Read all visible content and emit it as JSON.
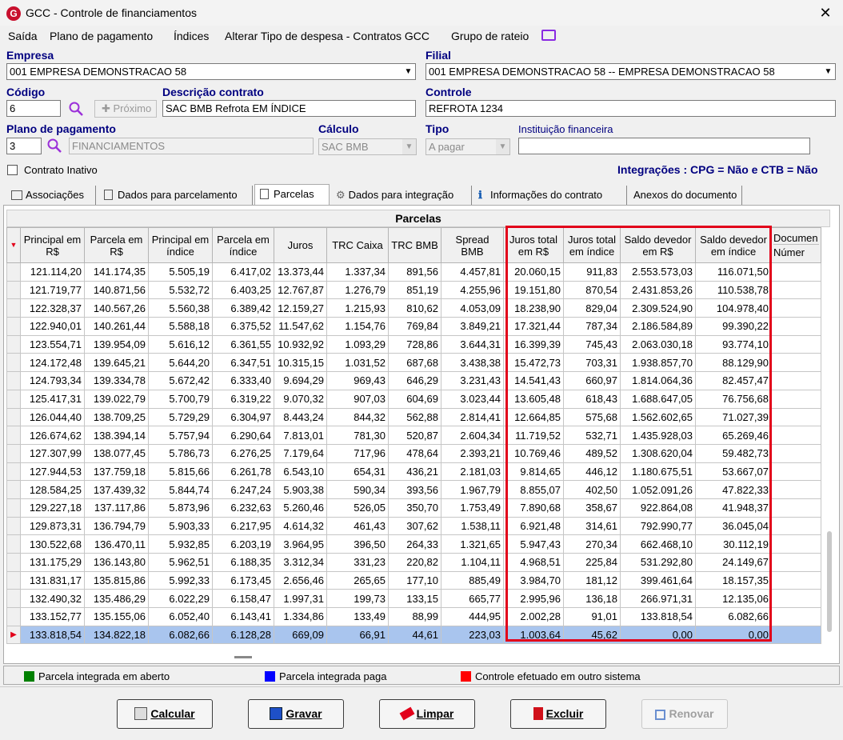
{
  "window": {
    "title": "GCC - Controle de financiamentos",
    "logo": "G",
    "close": "✕"
  },
  "menu": [
    "Saída",
    "Plano de pagamento",
    "Índices",
    "Alterar Tipo de despesa - Contratos GCC",
    "Grupo de rateio"
  ],
  "form": {
    "empresa_label": "Empresa",
    "empresa_value": "001 EMPRESA DEMONSTRACAO 58",
    "filial_label": "Filial",
    "filial_value": "001 EMPRESA DEMONSTRACAO 58 -- EMPRESA DEMONSTRACAO 58",
    "codigo_label": "Código",
    "codigo_value": "6",
    "proximo_label": "Próximo",
    "descricao_label": "Descrição contrato",
    "descricao_value": "SAC BMB Refrota EM ÍNDICE",
    "controle_label": "Controle",
    "controle_value": "REFROTA 1234",
    "plano_label": "Plano de pagamento",
    "plano_code": "3",
    "plano_name": "FINANCIAMENTOS",
    "calculo_label": "Cálculo",
    "calculo_value": "SAC BMB",
    "tipo_label": "Tipo",
    "tipo_value": "A pagar",
    "instituicao_label": "Instituição financeira",
    "instituicao_value": "",
    "inativo_label": "Contrato Inativo",
    "integracoes": "Integrações : CPG = Não e CTB = Não"
  },
  "tabs": [
    "Associações",
    "Dados para parcelamento",
    "Parcelas",
    "Dados para integração",
    "Informações do contrato",
    "Anexos do documento"
  ],
  "grid": {
    "caption": "Parcelas",
    "headers": [
      "Principal em R$",
      "Parcela em R$",
      "Principal em índice",
      "Parcela em índice",
      "Juros",
      "TRC Caixa",
      "TRC BMB",
      "Spread BMB",
      "Juros total em R$",
      "Juros total em índice",
      "Saldo devedor em R$",
      "Saldo devedor em índice"
    ],
    "header_extra_top": "Documen",
    "header_extra_bottom": "Númer",
    "rows": [
      [
        "121.114,20",
        "141.174,35",
        "5.505,19",
        "6.417,02",
        "13.373,44",
        "1.337,34",
        "891,56",
        "4.457,81",
        "20.060,15",
        "911,83",
        "2.553.573,03",
        "116.071,50"
      ],
      [
        "121.719,77",
        "140.871,56",
        "5.532,72",
        "6.403,25",
        "12.767,87",
        "1.276,79",
        "851,19",
        "4.255,96",
        "19.151,80",
        "870,54",
        "2.431.853,26",
        "110.538,78"
      ],
      [
        "122.328,37",
        "140.567,26",
        "5.560,38",
        "6.389,42",
        "12.159,27",
        "1.215,93",
        "810,62",
        "4.053,09",
        "18.238,90",
        "829,04",
        "2.309.524,90",
        "104.978,40"
      ],
      [
        "122.940,01",
        "140.261,44",
        "5.588,18",
        "6.375,52",
        "11.547,62",
        "1.154,76",
        "769,84",
        "3.849,21",
        "17.321,44",
        "787,34",
        "2.186.584,89",
        "99.390,22"
      ],
      [
        "123.554,71",
        "139.954,09",
        "5.616,12",
        "6.361,55",
        "10.932,92",
        "1.093,29",
        "728,86",
        "3.644,31",
        "16.399,39",
        "745,43",
        "2.063.030,18",
        "93.774,10"
      ],
      [
        "124.172,48",
        "139.645,21",
        "5.644,20",
        "6.347,51",
        "10.315,15",
        "1.031,52",
        "687,68",
        "3.438,38",
        "15.472,73",
        "703,31",
        "1.938.857,70",
        "88.129,90"
      ],
      [
        "124.793,34",
        "139.334,78",
        "5.672,42",
        "6.333,40",
        "9.694,29",
        "969,43",
        "646,29",
        "3.231,43",
        "14.541,43",
        "660,97",
        "1.814.064,36",
        "82.457,47"
      ],
      [
        "125.417,31",
        "139.022,79",
        "5.700,79",
        "6.319,22",
        "9.070,32",
        "907,03",
        "604,69",
        "3.023,44",
        "13.605,48",
        "618,43",
        "1.688.647,05",
        "76.756,68"
      ],
      [
        "126.044,40",
        "138.709,25",
        "5.729,29",
        "6.304,97",
        "8.443,24",
        "844,32",
        "562,88",
        "2.814,41",
        "12.664,85",
        "575,68",
        "1.562.602,65",
        "71.027,39"
      ],
      [
        "126.674,62",
        "138.394,14",
        "5.757,94",
        "6.290,64",
        "7.813,01",
        "781,30",
        "520,87",
        "2.604,34",
        "11.719,52",
        "532,71",
        "1.435.928,03",
        "65.269,46"
      ],
      [
        "127.307,99",
        "138.077,45",
        "5.786,73",
        "6.276,25",
        "7.179,64",
        "717,96",
        "478,64",
        "2.393,21",
        "10.769,46",
        "489,52",
        "1.308.620,04",
        "59.482,73"
      ],
      [
        "127.944,53",
        "137.759,18",
        "5.815,66",
        "6.261,78",
        "6.543,10",
        "654,31",
        "436,21",
        "2.181,03",
        "9.814,65",
        "446,12",
        "1.180.675,51",
        "53.667,07"
      ],
      [
        "128.584,25",
        "137.439,32",
        "5.844,74",
        "6.247,24",
        "5.903,38",
        "590,34",
        "393,56",
        "1.967,79",
        "8.855,07",
        "402,50",
        "1.052.091,26",
        "47.822,33"
      ],
      [
        "129.227,18",
        "137.117,86",
        "5.873,96",
        "6.232,63",
        "5.260,46",
        "526,05",
        "350,70",
        "1.753,49",
        "7.890,68",
        "358,67",
        "922.864,08",
        "41.948,37"
      ],
      [
        "129.873,31",
        "136.794,79",
        "5.903,33",
        "6.217,95",
        "4.614,32",
        "461,43",
        "307,62",
        "1.538,11",
        "6.921,48",
        "314,61",
        "792.990,77",
        "36.045,04"
      ],
      [
        "130.522,68",
        "136.470,11",
        "5.932,85",
        "6.203,19",
        "3.964,95",
        "396,50",
        "264,33",
        "1.321,65",
        "5.947,43",
        "270,34",
        "662.468,10",
        "30.112,19"
      ],
      [
        "131.175,29",
        "136.143,80",
        "5.962,51",
        "6.188,35",
        "3.312,34",
        "331,23",
        "220,82",
        "1.104,11",
        "4.968,51",
        "225,84",
        "531.292,80",
        "24.149,67"
      ],
      [
        "131.831,17",
        "135.815,86",
        "5.992,33",
        "6.173,45",
        "2.656,46",
        "265,65",
        "177,10",
        "885,49",
        "3.984,70",
        "181,12",
        "399.461,64",
        "18.157,35"
      ],
      [
        "132.490,32",
        "135.486,29",
        "6.022,29",
        "6.158,47",
        "1.997,31",
        "199,73",
        "133,15",
        "665,77",
        "2.995,96",
        "136,18",
        "266.971,31",
        "12.135,06"
      ],
      [
        "133.152,77",
        "135.155,06",
        "6.052,40",
        "6.143,41",
        "1.334,86",
        "133,49",
        "88,99",
        "444,95",
        "2.002,28",
        "91,01",
        "133.818,54",
        "6.082,66"
      ],
      [
        "133.818,54",
        "134.822,18",
        "6.082,66",
        "6.128,28",
        "669,09",
        "66,91",
        "44,61",
        "223,03",
        "1.003,64",
        "45,62",
        "0,00",
        "0,00"
      ]
    ]
  },
  "legend": [
    {
      "label": "Parcela integrada em aberto",
      "color": "#008000"
    },
    {
      "label": "Parcela integrada paga",
      "color": "#0000ff"
    },
    {
      "label": "Controle efetuado em outro sistema",
      "color": "#ff0000"
    }
  ],
  "buttons": {
    "calcular": "Calcular",
    "gravar": "Gravar",
    "limpar": "Limpar",
    "excluir": "Excluir",
    "renovar": "Renovar"
  }
}
